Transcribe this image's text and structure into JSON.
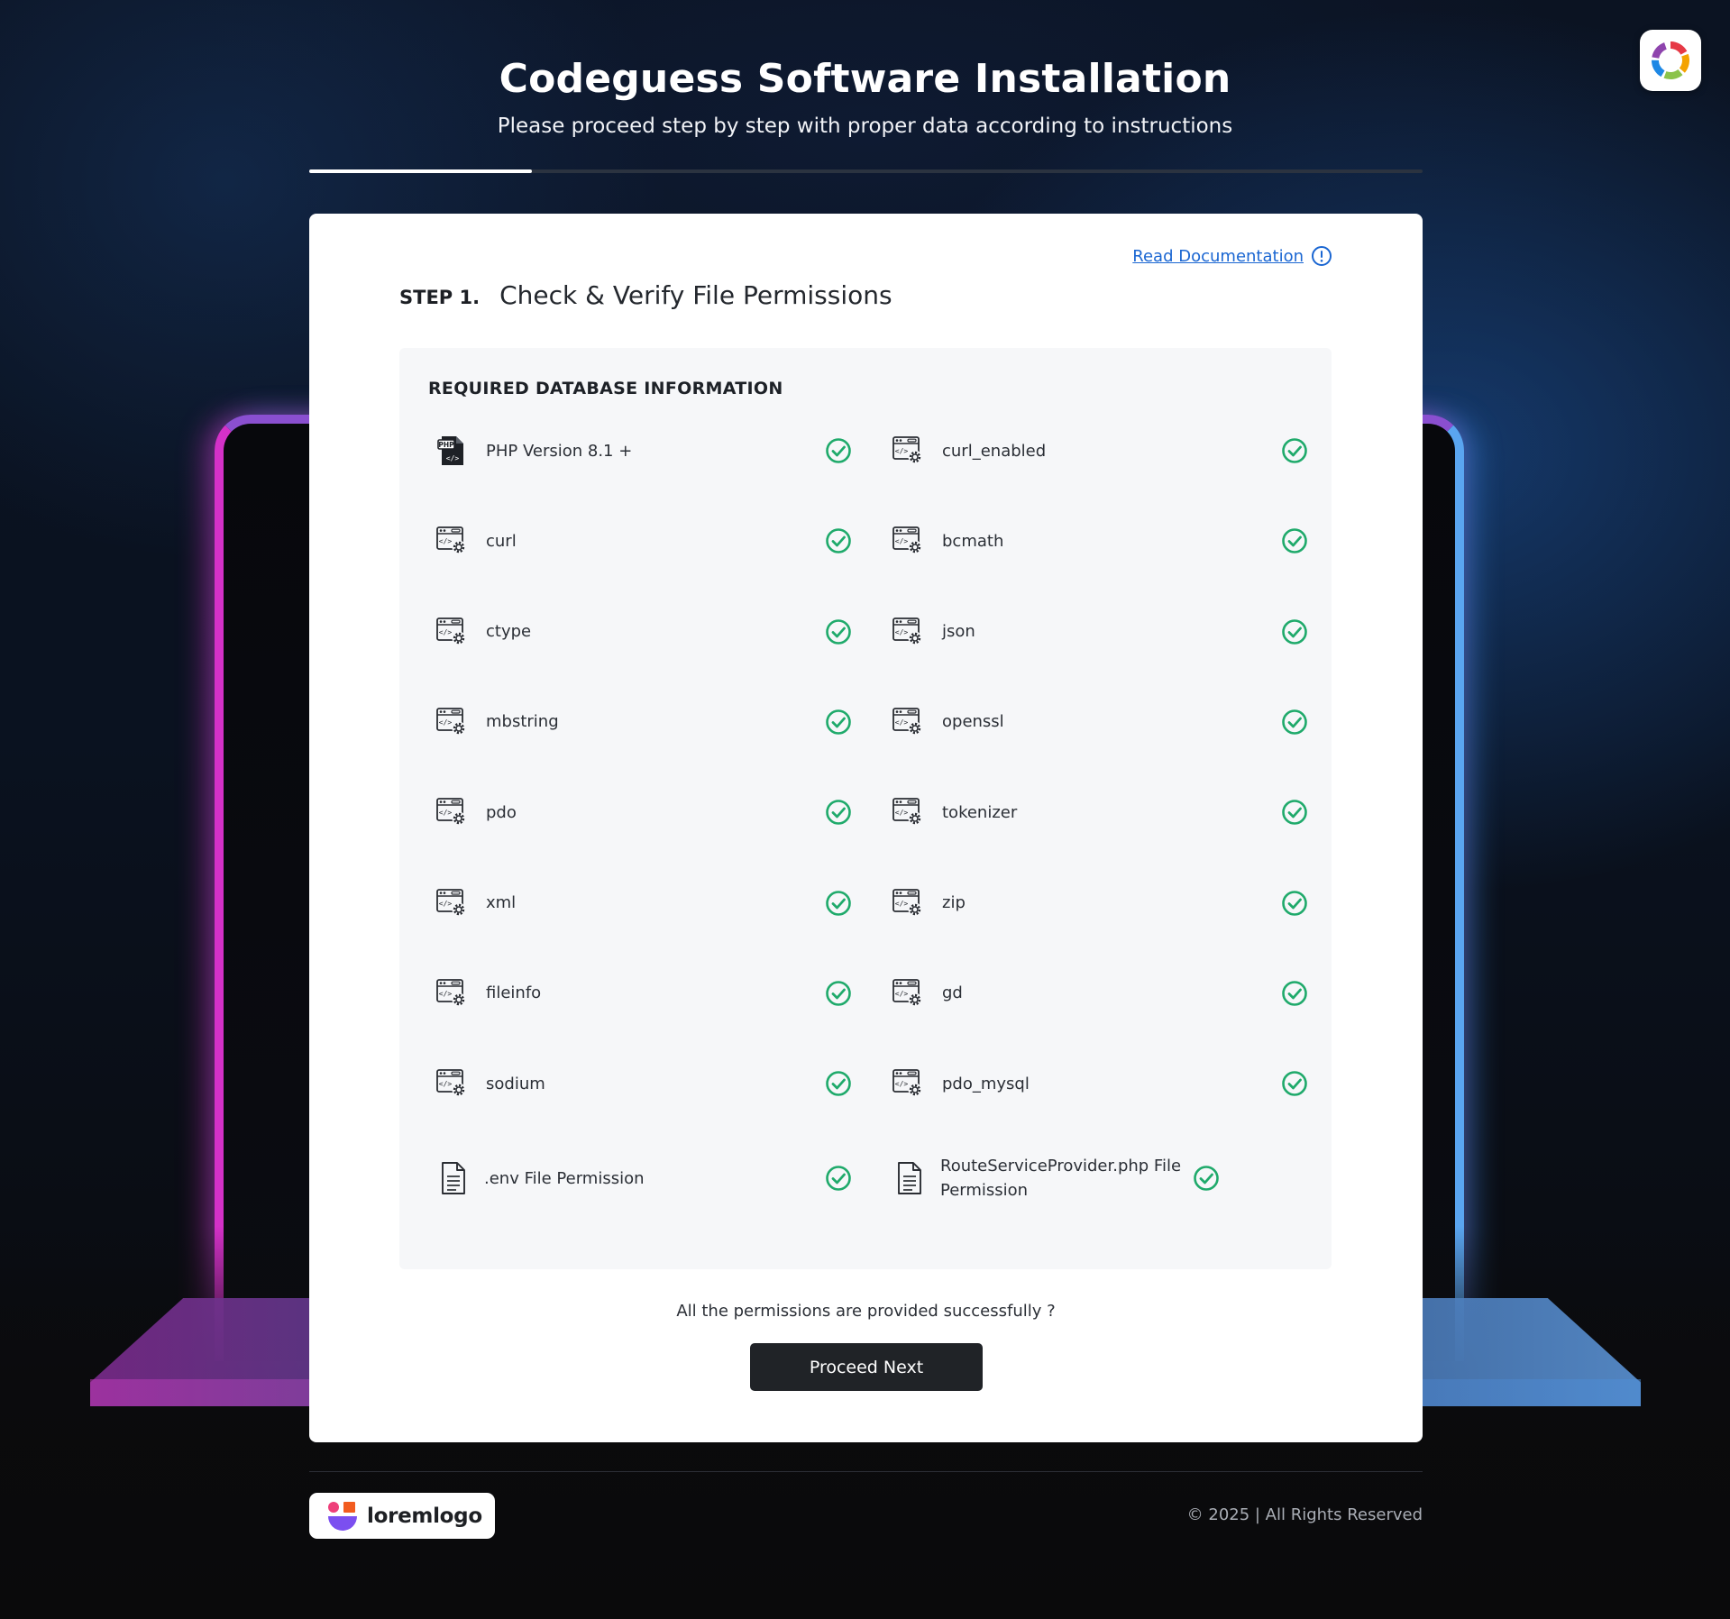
{
  "header": {
    "title": "Codeguess Software Installation",
    "subtitle": "Please proceed step by step with proper data according to instructions"
  },
  "progress": {
    "fraction": 0.2
  },
  "card": {
    "doc_link": "Read Documentation",
    "step_label": "STEP 1.",
    "step_title": "Check & Verify File Permissions",
    "panel_title": "REQUIRED DATABASE INFORMATION",
    "requirements": [
      {
        "label": "PHP Version 8.1 +",
        "icon": "php-file-icon",
        "status": "ok"
      },
      {
        "label": "curl_enabled",
        "icon": "extension-gear-icon",
        "status": "ok"
      },
      {
        "label": "curl",
        "icon": "extension-gear-icon",
        "status": "ok"
      },
      {
        "label": "bcmath",
        "icon": "extension-gear-icon",
        "status": "ok"
      },
      {
        "label": "ctype",
        "icon": "extension-gear-icon",
        "status": "ok"
      },
      {
        "label": "json",
        "icon": "extension-gear-icon",
        "status": "ok"
      },
      {
        "label": "mbstring",
        "icon": "extension-gear-icon",
        "status": "ok"
      },
      {
        "label": "openssl",
        "icon": "extension-gear-icon",
        "status": "ok"
      },
      {
        "label": "pdo",
        "icon": "extension-gear-icon",
        "status": "ok"
      },
      {
        "label": "tokenizer",
        "icon": "extension-gear-icon",
        "status": "ok"
      },
      {
        "label": "xml",
        "icon": "extension-gear-icon",
        "status": "ok"
      },
      {
        "label": "zip",
        "icon": "extension-gear-icon",
        "status": "ok"
      },
      {
        "label": "fileinfo",
        "icon": "extension-gear-icon",
        "status": "ok"
      },
      {
        "label": "gd",
        "icon": "extension-gear-icon",
        "status": "ok"
      },
      {
        "label": "sodium",
        "icon": "extension-gear-icon",
        "status": "ok"
      },
      {
        "label": "pdo_mysql",
        "icon": "extension-gear-icon",
        "status": "ok"
      },
      {
        "label": ".env File Permission",
        "icon": "document-icon",
        "status": "ok"
      },
      {
        "label": "RouteServiceProvider.php File Permission",
        "icon": "document-icon",
        "status": "ok"
      }
    ],
    "confirm_text": "All the permissions are provided successfully ?",
    "proceed_label": "Proceed Next"
  },
  "footer": {
    "logo_text": "loremlogo",
    "copyright": "© 2025 | All Rights Reserved"
  },
  "colors": {
    "check_green": "#1faa6b",
    "link_blue": "#1a66d2",
    "button_dark": "#202327",
    "panel_bg": "#f6f7f9"
  }
}
